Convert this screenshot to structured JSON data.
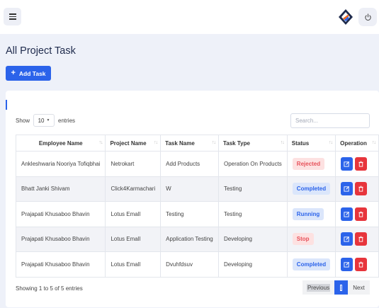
{
  "header": {
    "menu_icon": "hamburger-menu-icon",
    "logo_icon": "brand-logo-icon",
    "power_icon": "power-icon"
  },
  "page": {
    "title": "All Project Task",
    "add_button_label": "Add Task"
  },
  "controls": {
    "show_label": "Show",
    "entries_value": "10",
    "entries_label": "entries",
    "search_placeholder": "Search..."
  },
  "table": {
    "columns": [
      "Employee Name",
      "Project Name",
      "Task Name",
      "Task Type",
      "Status",
      "Operation"
    ],
    "rows": [
      {
        "employee": "Ankleshwaria Nooriya Tofiqbhai",
        "project": "Netrokart",
        "task": "Add Products",
        "type": "Operation On Products",
        "status": "Rejected",
        "status_kind": "rejected"
      },
      {
        "employee": "Bhatt Janki Shivam",
        "project": "Click4Karmachari",
        "task": "W",
        "type": "Testing",
        "status": "Completed",
        "status_kind": "completed"
      },
      {
        "employee": "Prajapati Khusaboo Bhavin",
        "project": "Lotus Emall",
        "task": "Testing",
        "type": "Testing",
        "status": "Running",
        "status_kind": "running"
      },
      {
        "employee": "Prajapati Khusaboo Bhavin",
        "project": "Lotus Emall",
        "task": "Application Testing",
        "type": "Developing",
        "status": "Stop",
        "status_kind": "stop"
      },
      {
        "employee": "Prajapati Khusaboo Bhavin",
        "project": "Lotus Emall",
        "task": "Dvuhfdsuv",
        "type": "Developing",
        "status": "Completed",
        "status_kind": "completed"
      }
    ]
  },
  "footer": {
    "info": "Showing 1 to 5 of 5 entries",
    "previous_label": "Previous",
    "next_label": "Next"
  },
  "colors": {
    "primary": "#2b63ea",
    "danger": "#e7353c",
    "background": "#eef1f9"
  }
}
